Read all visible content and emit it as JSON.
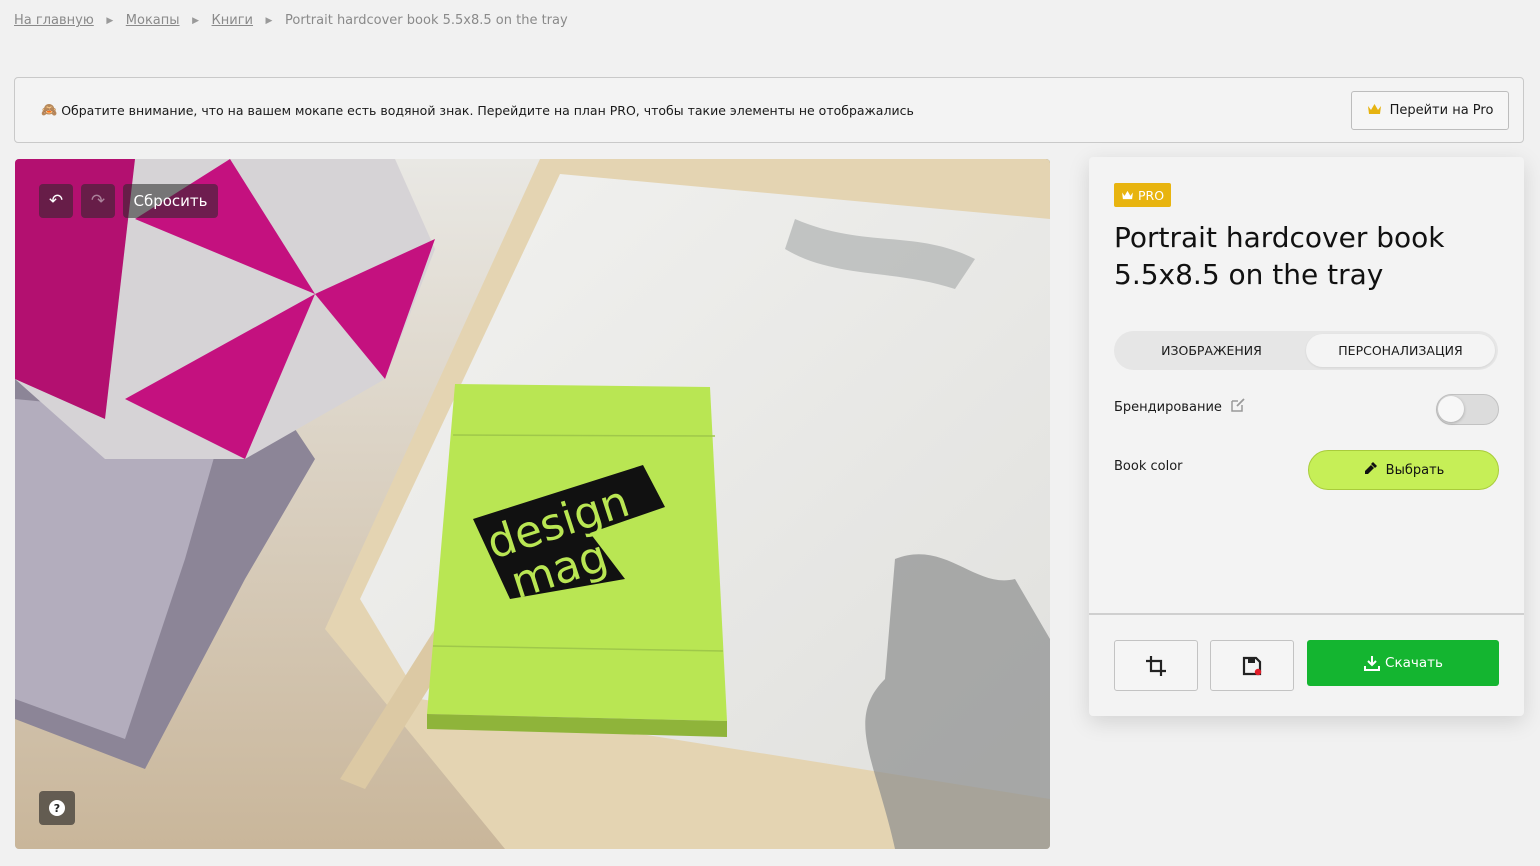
{
  "breadcrumb": {
    "items": [
      {
        "label": "На главную"
      },
      {
        "label": "Мокапы"
      },
      {
        "label": "Книги"
      }
    ],
    "current": "Portrait hardcover book 5.5x8.5 on the tray"
  },
  "notice": {
    "emoji": "🙈",
    "text": "Обратите внимание, что на вашем мокапе есть водяной знак. Перейдите на план PRO, чтобы такие элементы не отображались",
    "pro_button": "Перейти на Pro"
  },
  "editor": {
    "reset_label": "Сбросить",
    "help_label": "?",
    "book_text_line1": "design",
    "book_text_line2": "mag"
  },
  "panel": {
    "badge": "PRO",
    "title": "Portrait hardcover book 5.5x8.5 on the tray",
    "tabs": [
      {
        "label": "ИЗОБРАЖЕНИЯ",
        "active": false
      },
      {
        "label": "ПЕРСОНАЛИЗАЦИЯ",
        "active": true
      }
    ],
    "branding_label": "Брендирование",
    "branding_enabled": false,
    "book_color_label": "Book color",
    "choose_label": "Выбрать",
    "download_label": "Скачать"
  },
  "colors": {
    "accent_green": "#14b530",
    "lime": "#c6ef57",
    "pro_gold": "#e8b40f",
    "book_cover": "#b9e653",
    "pillow_magenta": "#c4117f"
  },
  "icons": {
    "undo": "undo-icon",
    "redo": "redo-icon",
    "crown": "crown-icon",
    "edit": "edit-icon",
    "eyedropper": "eyedropper-icon",
    "crop": "crop-icon",
    "save": "save-icon",
    "download": "download-icon",
    "help": "help-icon"
  }
}
